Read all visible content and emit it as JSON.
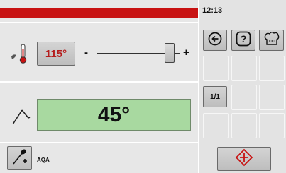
{
  "status_bar": {
    "time": "12:13",
    "alert_color": "#c81212"
  },
  "temperature": {
    "setpoint": "115°",
    "icon": "thermometer-icon",
    "value_color": "#b51e1e"
  },
  "slider": {
    "minus_label": "-",
    "plus_label": "+",
    "level": 0.85
  },
  "probe": {
    "icon": "core-probe-icon",
    "display_value": "45°",
    "display_color": "#a8d9a0"
  },
  "aqa": {
    "label": "AQA",
    "icon": "add-probe-icon"
  },
  "right_panel": {
    "back_icon": "back-arrow-icon",
    "help_icon": "help-icon",
    "chef_icon": "chef-hat-cc-icon",
    "tray_label": "1/1",
    "start_icon": "start-diamond-icon",
    "start_color": "#c81212"
  }
}
